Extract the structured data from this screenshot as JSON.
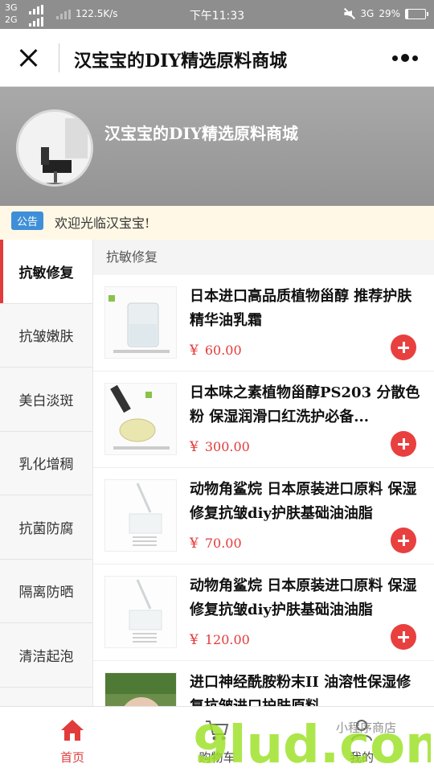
{
  "status_bar": {
    "network_1": "3G",
    "network_2": "2G",
    "speed": "122.5K/s",
    "time": "下午11:33",
    "network_right": "3G",
    "battery": "29%"
  },
  "header": {
    "title": "汉宝宝的DIY精选原料商城"
  },
  "banner": {
    "shop_name": "汉宝宝的DIY精选原料商城"
  },
  "notice": {
    "badge": "公告",
    "text": "欢迎光临汉宝宝!"
  },
  "sidebar": {
    "items": [
      {
        "label": "抗敏修复"
      },
      {
        "label": "抗皱嫩肤"
      },
      {
        "label": "美白淡斑"
      },
      {
        "label": "乳化增稠"
      },
      {
        "label": "抗菌防腐"
      },
      {
        "label": "隔离防晒"
      },
      {
        "label": "清洁起泡"
      }
    ],
    "active_index": 0
  },
  "main": {
    "section_title": "抗敏修复",
    "currency": "¥",
    "products": [
      {
        "name": "日本进口高品质植物甾醇 推荐护肤精华油乳霜",
        "price": "60.00"
      },
      {
        "name": "日本味之素植物甾醇PS203 分散色粉 保湿润滑口红洗护必备...",
        "price": "300.00"
      },
      {
        "name": "动物角鲨烷 日本原装进口原料 保湿修复抗皱diy护肤基础油油脂",
        "price": "70.00"
      },
      {
        "name": "动物角鲨烷 日本原装进口原料 保湿修复抗皱diy护肤基础油油脂",
        "price": "120.00"
      },
      {
        "name": "进口神经酰胺粉末II 油溶性保湿修复抗皱进口护肤原料",
        "price": ""
      }
    ]
  },
  "tabbar": {
    "tabs": [
      {
        "label": "首页"
      },
      {
        "label": "购物车"
      },
      {
        "label": "我的"
      }
    ]
  },
  "watermark": {
    "text": "9lud.com",
    "sub": "小程序商店"
  },
  "colors": {
    "accent": "#e23b3b",
    "badge": "#3f8fd8",
    "banner": "#9d9d9d"
  }
}
